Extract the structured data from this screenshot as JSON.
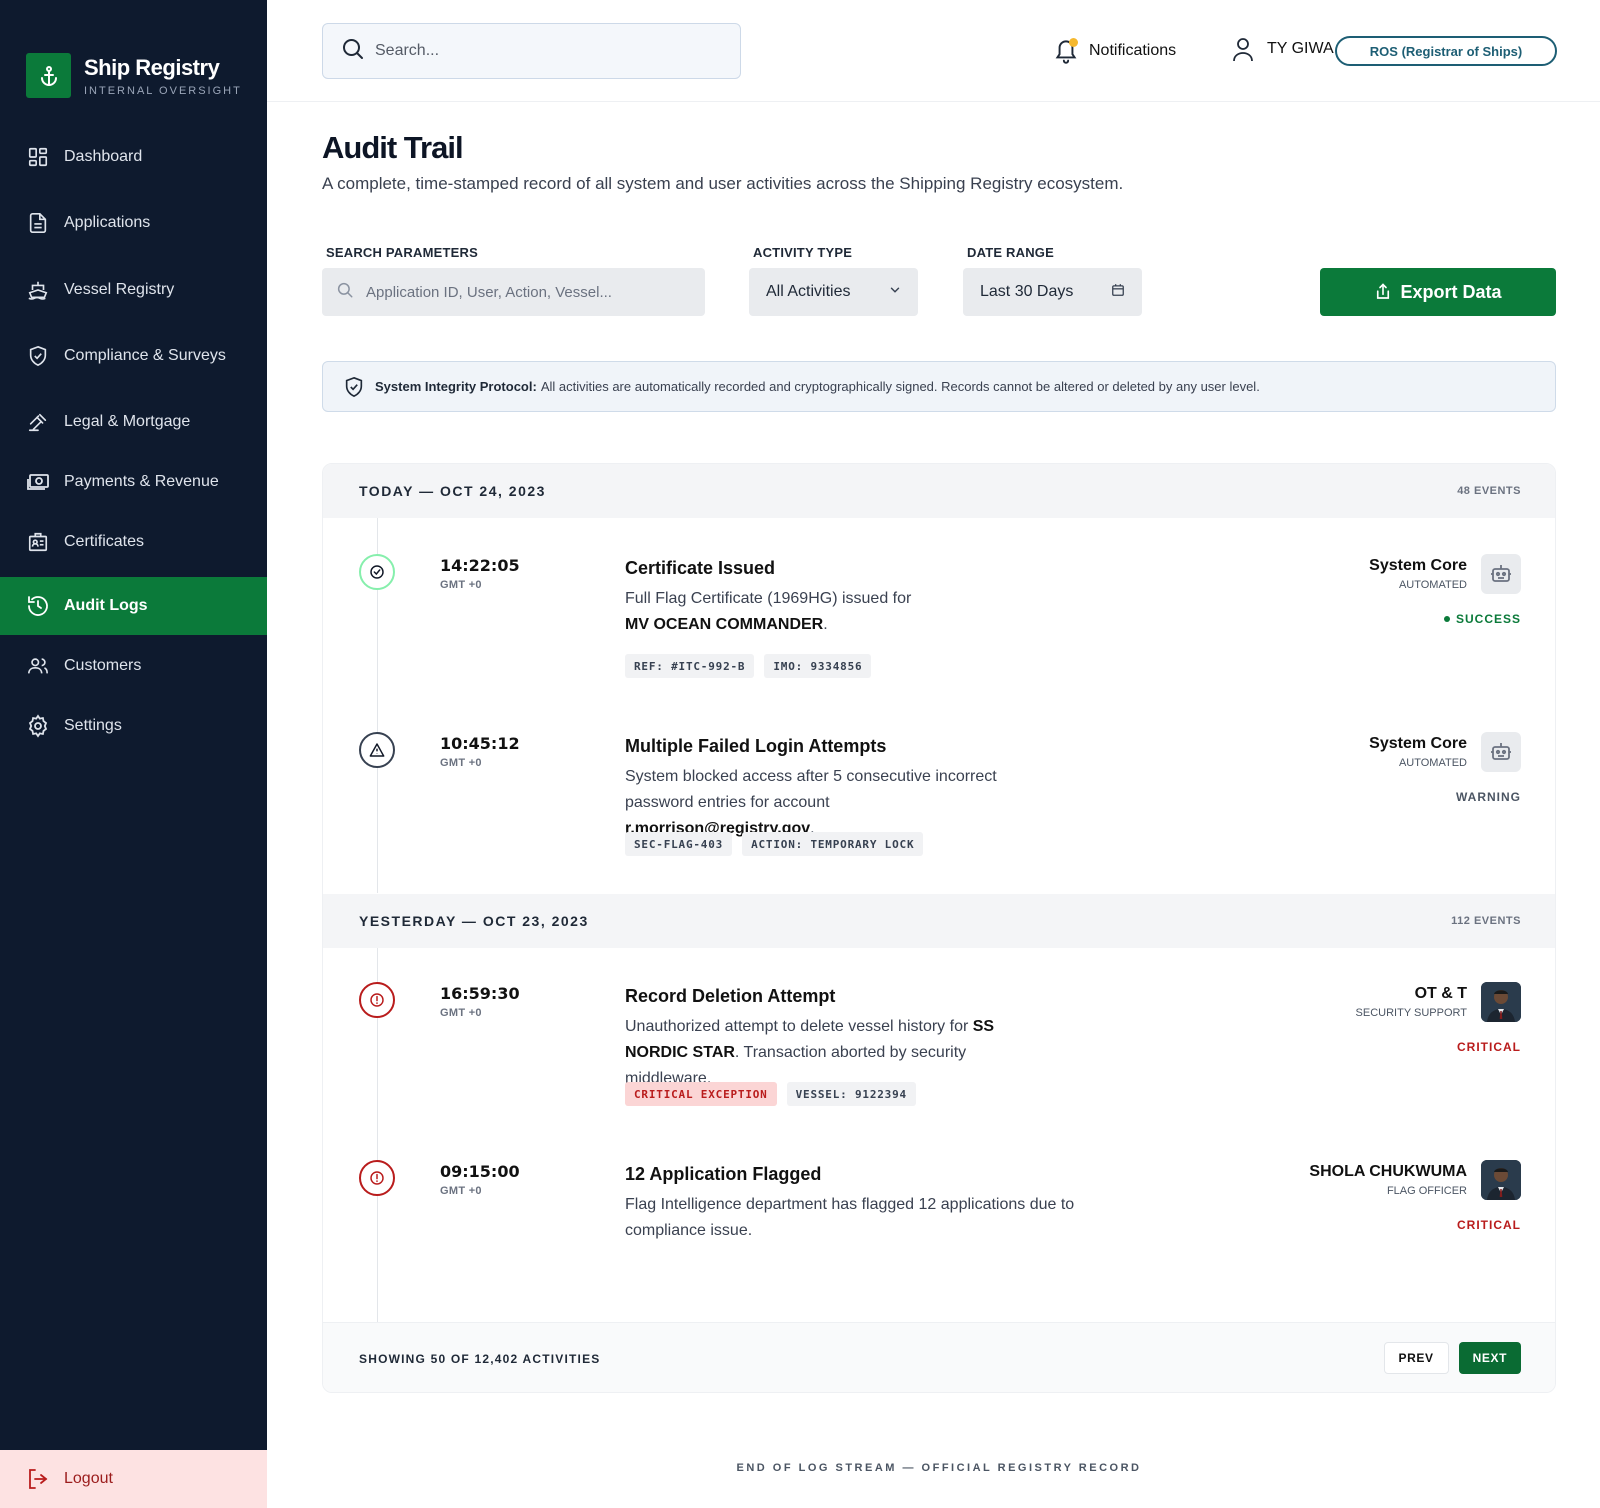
{
  "brand": {
    "title": "Ship Registry",
    "subtitle": "INTERNAL OVERSIGHT"
  },
  "sidebar": {
    "items": [
      {
        "label": "Dashboard",
        "icon": "grid-icon"
      },
      {
        "label": "Applications",
        "icon": "document-icon"
      },
      {
        "label": "Vessel Registry",
        "icon": "ship-icon"
      },
      {
        "label": "Compliance & Surveys",
        "icon": "shield-check-icon"
      },
      {
        "label": "Legal & Mortgage",
        "icon": "gavel-icon"
      },
      {
        "label": "Payments & Revenue",
        "icon": "cash-icon"
      },
      {
        "label": "Certificates",
        "icon": "id-badge-icon"
      },
      {
        "label": "Audit Logs",
        "icon": "history-icon",
        "active": true
      },
      {
        "label": "Customers",
        "icon": "users-icon"
      },
      {
        "label": "Settings",
        "icon": "gear-icon"
      }
    ],
    "logout_label": "Logout"
  },
  "topbar": {
    "search_placeholder": "Search...",
    "notifications_label": "Notifications",
    "user_name": "TY GIWA",
    "role": "ROS (Registrar of Ships)"
  },
  "page": {
    "title": "Audit Trail",
    "description": "A complete, time-stamped record of all system and user activities across the Shipping Registry ecosystem."
  },
  "filters": {
    "search_label": "SEARCH PARAMETERS",
    "search_placeholder": "Application ID, User, Action, Vessel...",
    "activity_label": "ACTIVITY TYPE",
    "activity_value": "All Activities",
    "date_label": "DATE RANGE",
    "date_value": "Last 30 Days",
    "export_label": "Export Data"
  },
  "protocol": {
    "title": "System Integrity Protocol:",
    "text": "All activities are automatically recorded and cryptographically signed. Records cannot be altered or deleted by any user level."
  },
  "days": [
    {
      "title": "TODAY — OCT 24, 2023",
      "count": "48 EVENTS",
      "events": [
        {
          "time": "14:22:05",
          "tz": "GMT +0",
          "title": "Certificate Issued",
          "desc_pre": "Full Flag Certificate (1969HG) issued for ",
          "desc_bold": "MV OCEAN COMMANDER",
          "desc_post": ".",
          "tags": [
            "REF: #ITC-992-B",
            "IMO: 9334856"
          ],
          "actor": "System Core",
          "actor_role": "AUTOMATED",
          "status": "SUCCESS",
          "status_color": "#0b7a3a",
          "icon_color": "#22c55e"
        },
        {
          "time": "10:45:12",
          "tz": "GMT +0",
          "title": "Multiple Failed Login Attempts",
          "desc_pre": "System blocked access after 5 consecutive incorrect password entries for account ",
          "desc_bold": "r.morrison@registry.gov",
          "desc_post": ".",
          "tags": [
            "SEC-FLAG-403",
            "ACTION: TEMPORARY LOCK"
          ],
          "actor": "System Core",
          "actor_role": "AUTOMATED",
          "status": "WARNING",
          "status_color": "#4b5563",
          "icon_color": "#374151"
        }
      ]
    },
    {
      "title": "YESTERDAY — OCT 23, 2023",
      "count": "112 EVENTS",
      "events": [
        {
          "time": "16:59:30",
          "tz": "GMT +0",
          "title": "Record Deletion Attempt",
          "desc_pre": "Unauthorized attempt to delete vessel history for ",
          "desc_bold": "SS NORDIC STAR",
          "desc_post": ". Transaction aborted by security middleware.",
          "tags": [
            "CRITICAL EXCEPTION",
            "VESSEL: 9122394"
          ],
          "actor": "OT & T",
          "actor_role": "SECURITY SUPPORT",
          "status": "CRITICAL",
          "status_color": "#b91c1c",
          "icon_color": "#b91c1c"
        },
        {
          "time": "09:15:00",
          "tz": "GMT +0",
          "title": "12 Application Flagged",
          "desc_pre": "Flag Intelligence department has flagged 12 applications due to compliance issue.",
          "desc_bold": "",
          "desc_post": "",
          "tags": [],
          "actor": "SHOLA CHUKWUMA",
          "actor_role": "FLAG OFFICER",
          "status": "CRITICAL",
          "status_color": "#b91c1c",
          "icon_color": "#b91c1c"
        }
      ]
    }
  ],
  "footer": {
    "showing": "SHOWING 50 OF 12,402 ACTIVITIES",
    "prev": "PREV",
    "next": "NEXT",
    "end_stream": "END OF LOG STREAM — OFFICIAL REGISTRY RECORD"
  }
}
